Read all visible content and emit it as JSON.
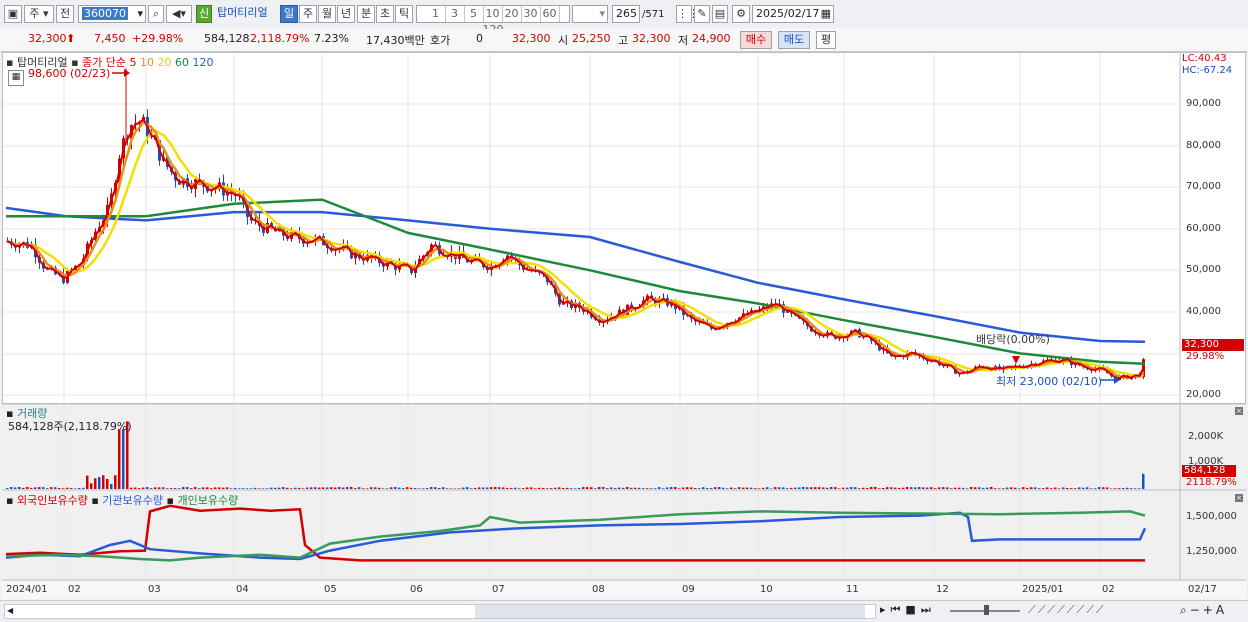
{
  "toolbar": {
    "type_label": "주",
    "prev_label": "전",
    "code": "360070",
    "new_badge": "신",
    "name": "탑머티리얼",
    "periods": [
      "일",
      "주",
      "월",
      "년",
      "분",
      "초",
      "틱"
    ],
    "minutes": [
      "1",
      "3",
      "5",
      "10",
      "20",
      "30",
      "60",
      "120"
    ],
    "count": "265",
    "total": "/571",
    "date": "2025/02/17"
  },
  "quote": {
    "price": "32,300",
    "change": "7,450",
    "rate": "+29.98%",
    "volume": "584,128",
    "vol_rate": "2,118.79%",
    "turnover": "7.23%",
    "amount": "17,430백만",
    "hoga_label": "호가",
    "hoga_value": "0",
    "hoga_price": "32,300",
    "open_label": "시",
    "open": "25,250",
    "high_label": "고",
    "high": "32,300",
    "low_label": "저",
    "low": "24,900",
    "buy_label": "매수",
    "sell_label": "매도",
    "eval_label": "평"
  },
  "price_panel": {
    "title": "탑머티리얼",
    "legend_main": "종가 단순",
    "ma_periods": [
      {
        "label": "5",
        "color": "#d40000"
      },
      {
        "label": "10",
        "color": "#e8901a"
      },
      {
        "label": "20",
        "color": "#e6d200"
      },
      {
        "label": "60",
        "color": "#1e8a3a"
      },
      {
        "label": "120",
        "color": "#2a5ad8"
      }
    ],
    "high_marker": "98,600 (02/23)",
    "low_marker": "최저 23,000 (02/10)",
    "dividend_marker": "배당락(0.00%)",
    "lc": "LC:40.43",
    "hc": "HC:-67.24",
    "y_ticks": [
      "90,000",
      "80,000",
      "70,000",
      "60,000",
      "50,000",
      "40,000",
      "20,000"
    ],
    "current_price": "32,300",
    "current_rate": "29.98%"
  },
  "volume_panel": {
    "title": "거래량",
    "subtitle": "584,128주(2,118.79%)",
    "y_ticks": [
      "2,000K",
      "1,000K"
    ],
    "current": "584,128",
    "current_rate": "2118.79%"
  },
  "holdings_panel": {
    "legend": [
      {
        "label": "외국인보유수량",
        "color": "#d40000"
      },
      {
        "label": "기관보유수량",
        "color": "#2a5ad8"
      },
      {
        "label": "개인보유수량",
        "color": "#1e8a3a"
      }
    ],
    "y_ticks": [
      "1,500,000",
      "1,250,000"
    ]
  },
  "x_axis": [
    "2024/01",
    "02",
    "03",
    "04",
    "05",
    "06",
    "07",
    "08",
    "09",
    "10",
    "11",
    "12",
    "2025/01",
    "02",
    "02/17"
  ],
  "chart_data": {
    "type": "line",
    "title": "탑머티리얼",
    "x": [
      "2024/01",
      "02",
      "03",
      "04",
      "05",
      "06",
      "07",
      "08",
      "09",
      "10",
      "11",
      "12",
      "2025/01",
      "02"
    ],
    "series": [
      {
        "name": "5",
        "values": [
          57000,
          50000,
          85000,
          70000,
          55000,
          52000,
          53000,
          42000,
          38000,
          43000,
          33000,
          27000,
          28000,
          25000
        ]
      },
      {
        "name": "60",
        "values": [
          63000,
          63000,
          63000,
          66000,
          67000,
          59000,
          55000,
          50000,
          45000,
          42000,
          38000,
          34000,
          30000,
          28000
        ]
      },
      {
        "name": "120",
        "values": [
          65000,
          63000,
          62000,
          64000,
          64000,
          62000,
          60000,
          58000,
          52000,
          47000,
          43000,
          39000,
          35000,
          33000
        ]
      }
    ],
    "ylim": [
      20000,
      100000
    ]
  }
}
